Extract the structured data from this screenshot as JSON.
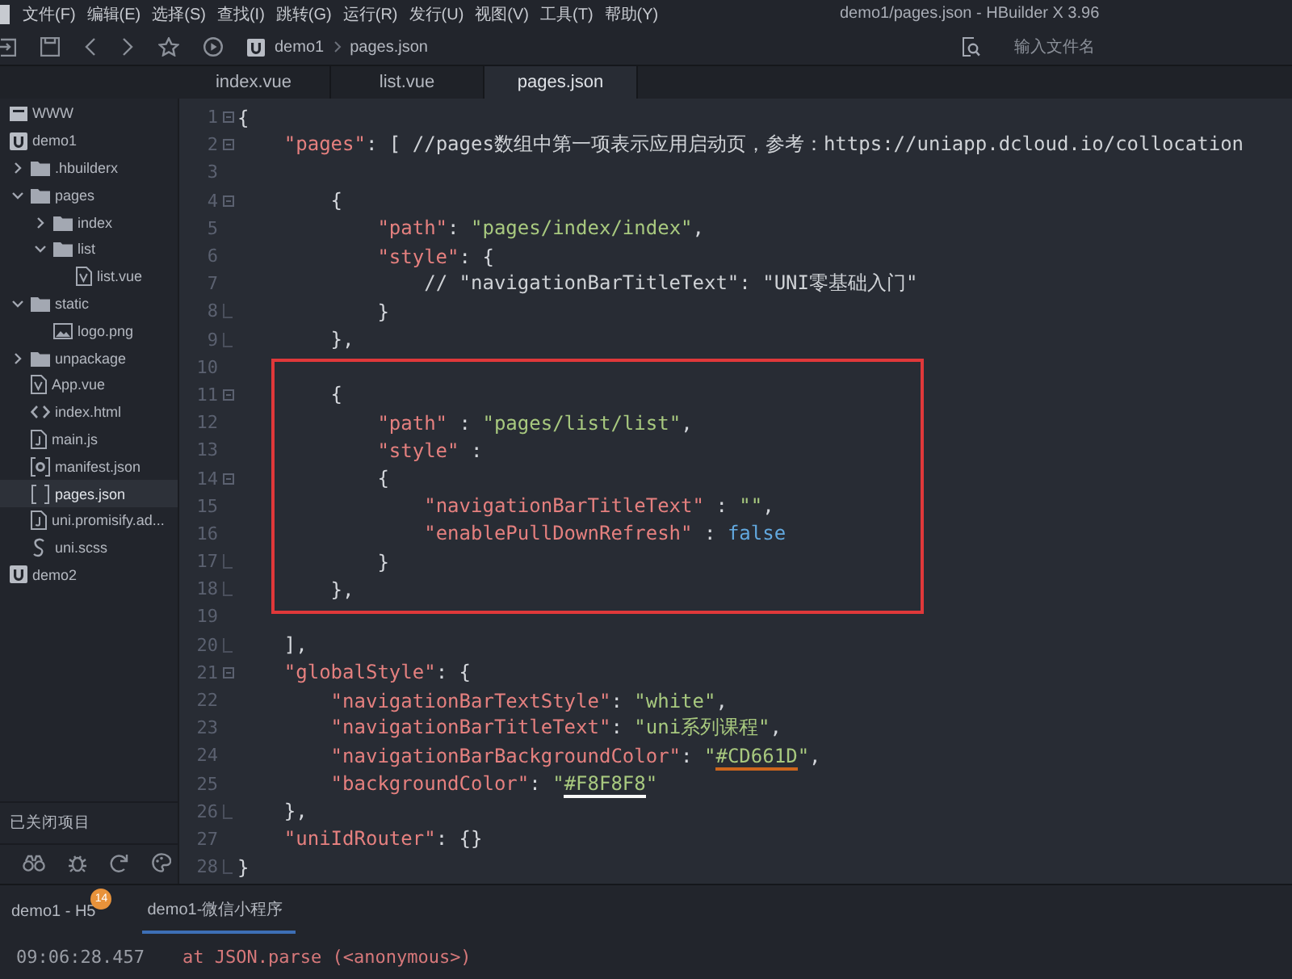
{
  "window": {
    "title": "demo1/pages.json - HBuilder X 3.96"
  },
  "menu": [
    "文件(F)",
    "编辑(E)",
    "选择(S)",
    "查找(I)",
    "跳转(G)",
    "运行(R)",
    "发行(U)",
    "视图(V)",
    "工具(T)",
    "帮助(Y)"
  ],
  "toolbar": {
    "breadcrumb": [
      "demo1",
      "pages.json"
    ],
    "search": {
      "placeholder": "输入文件名"
    }
  },
  "tabs": [
    {
      "label": "index.vue",
      "selected": false
    },
    {
      "label": "list.vue",
      "selected": false
    },
    {
      "label": "pages.json",
      "selected": true
    }
  ],
  "sidebar": {
    "tree": [
      {
        "label": "WWW",
        "kind": "workspace",
        "selected": false
      },
      {
        "label": "demo1",
        "kind": "project",
        "selected": false,
        "children": [
          {
            "label": ".hbuilderx",
            "kind": "folder",
            "expanded": false,
            "selected": false
          },
          {
            "label": "pages",
            "kind": "folder",
            "expanded": true,
            "selected": false,
            "children": [
              {
                "label": "index",
                "kind": "folder",
                "expanded": false,
                "selected": false
              },
              {
                "label": "list",
                "kind": "folder",
                "expanded": true,
                "selected": false,
                "children": [
                  {
                    "label": "list.vue",
                    "kind": "vue",
                    "selected": false
                  }
                ]
              }
            ]
          },
          {
            "label": "static",
            "kind": "folder",
            "expanded": true,
            "selected": false,
            "children": [
              {
                "label": "logo.png",
                "kind": "image",
                "selected": false
              }
            ]
          },
          {
            "label": "unpackage",
            "kind": "folder",
            "expanded": false,
            "selected": false
          },
          {
            "label": "App.vue",
            "kind": "vue",
            "selected": false
          },
          {
            "label": "index.html",
            "kind": "html",
            "selected": false
          },
          {
            "label": "main.js",
            "kind": "js",
            "selected": false
          },
          {
            "label": "manifest.json",
            "kind": "manifest",
            "selected": false
          },
          {
            "label": "pages.json",
            "kind": "json",
            "selected": true
          },
          {
            "label": "uni.promisify.ad...",
            "kind": "js",
            "selected": false
          },
          {
            "label": "uni.scss",
            "kind": "scss",
            "selected": false
          }
        ]
      },
      {
        "label": "demo2",
        "kind": "project",
        "selected": false
      }
    ],
    "closed_projects_label": "已关闭项目"
  },
  "editor": {
    "lines": [
      {
        "number": "1",
        "foldable": true,
        "tokens": [
          {
            "kind": "punct",
            "text": "{"
          }
        ],
        "children": [
          {
            "number": "2",
            "foldable": true,
            "tokens": [
              {
                "kind": "key",
                "text": "\"pages\""
              },
              {
                "kind": "punct",
                "text": ": [ "
              },
              {
                "kind": "comment",
                "text": "//pages数组中第一项表示应用启动页，参考：https://uniapp.dcloud.io/collocation"
              }
            ],
            "children": [
              {
                "number": "3"
              },
              {
                "number": "4",
                "foldable": true,
                "tokens": [
                  {
                    "kind": "punct",
                    "text": "{"
                  }
                ],
                "children": [
                  {
                    "number": "5",
                    "tokens": [
                      {
                        "kind": "key",
                        "text": "\"path\""
                      },
                      {
                        "kind": "punct",
                        "text": ": "
                      },
                      {
                        "kind": "str",
                        "text": "\"pages/index/index\""
                      },
                      {
                        "kind": "punct",
                        "text": ","
                      }
                    ]
                  },
                  {
                    "number": "6",
                    "tokens": [
                      {
                        "kind": "key",
                        "text": "\"style\""
                      },
                      {
                        "kind": "punct",
                        "text": ": {"
                      }
                    ],
                    "children": [
                      {
                        "number": "7",
                        "tokens": [
                          {
                            "kind": "comment",
                            "text": "// \"navigationBarTitleText\": \"UNI零基础入门\""
                          }
                        ]
                      }
                    ]
                  },
                  {
                    "number": "8",
                    "fold_end": true,
                    "tokens": [
                      {
                        "kind": "punct",
                        "text": "}"
                      }
                    ]
                  }
                ]
              },
              {
                "number": "9",
                "fold_end": true,
                "tokens": [
                  {
                    "kind": "punct",
                    "text": "},"
                  }
                ]
              },
              {
                "number": "10",
                "boxed": true
              },
              {
                "number": "11",
                "foldable": true,
                "boxed": true,
                "tokens": [
                  {
                    "kind": "punct",
                    "text": "{"
                  }
                ],
                "children": [
                  {
                    "number": "12",
                    "boxed": true,
                    "tokens": [
                      {
                        "kind": "key",
                        "text": "\"path\""
                      },
                      {
                        "kind": "punct",
                        "text": " : "
                      },
                      {
                        "kind": "str",
                        "text": "\"pages/list/list\""
                      },
                      {
                        "kind": "punct",
                        "text": ","
                      }
                    ]
                  },
                  {
                    "number": "13",
                    "boxed": true,
                    "tokens": [
                      {
                        "kind": "key",
                        "text": "\"style\""
                      },
                      {
                        "kind": "punct",
                        "text": " :"
                      }
                    ]
                  },
                  {
                    "number": "14",
                    "foldable": true,
                    "boxed": true,
                    "tokens": [
                      {
                        "kind": "punct",
                        "text": "{"
                      }
                    ],
                    "children": [
                      {
                        "number": "15",
                        "boxed": true,
                        "tokens": [
                          {
                            "kind": "key",
                            "text": "\"navigationBarTitleText\""
                          },
                          {
                            "kind": "punct",
                            "text": " : "
                          },
                          {
                            "kind": "str",
                            "text": "\"\""
                          },
                          {
                            "kind": "punct",
                            "text": ","
                          }
                        ]
                      },
                      {
                        "number": "16",
                        "boxed": true,
                        "tokens": [
                          {
                            "kind": "key",
                            "text": "\"enablePullDownRefresh\""
                          },
                          {
                            "kind": "punct",
                            "text": " : "
                          },
                          {
                            "kind": "bool",
                            "text": "false"
                          }
                        ]
                      }
                    ]
                  },
                  {
                    "number": "17",
                    "fold_end": true,
                    "boxed": true,
                    "tokens": [
                      {
                        "kind": "punct",
                        "text": "}"
                      }
                    ]
                  }
                ]
              },
              {
                "number": "18",
                "fold_end": true,
                "boxed": true,
                "tokens": [
                  {
                    "kind": "punct",
                    "text": "},"
                  }
                ]
              },
              {
                "number": "19"
              }
            ]
          },
          {
            "number": "20",
            "fold_end": true,
            "tokens": [
              {
                "kind": "punct",
                "text": "],"
              }
            ]
          },
          {
            "number": "21",
            "foldable": true,
            "tokens": [
              {
                "kind": "key",
                "text": "\"globalStyle\""
              },
              {
                "kind": "punct",
                "text": ": {"
              }
            ],
            "children": [
              {
                "number": "22",
                "tokens": [
                  {
                    "kind": "key",
                    "text": "\"navigationBarTextStyle\""
                  },
                  {
                    "kind": "punct",
                    "text": ": "
                  },
                  {
                    "kind": "str",
                    "text": "\"white\""
                  },
                  {
                    "kind": "punct",
                    "text": ","
                  }
                ]
              },
              {
                "number": "23",
                "tokens": [
                  {
                    "kind": "key",
                    "text": "\"navigationBarTitleText\""
                  },
                  {
                    "kind": "punct",
                    "text": ": "
                  },
                  {
                    "kind": "str",
                    "text": "\"uni系列课程\""
                  },
                  {
                    "kind": "punct",
                    "text": ","
                  }
                ]
              },
              {
                "number": "24",
                "tokens": [
                  {
                    "kind": "key",
                    "text": "\"navigationBarBackgroundColor\""
                  },
                  {
                    "kind": "punct",
                    "text": ": "
                  },
                  {
                    "kind": "str",
                    "text": "\""
                  },
                  {
                    "kind": "color",
                    "text": "#CD661D",
                    "color": "#cd661d"
                  },
                  {
                    "kind": "str",
                    "text": "\""
                  },
                  {
                    "kind": "punct",
                    "text": ","
                  }
                ]
              },
              {
                "number": "25",
                "tokens": [
                  {
                    "kind": "key",
                    "text": "\"backgroundColor\""
                  },
                  {
                    "kind": "punct",
                    "text": ": "
                  },
                  {
                    "kind": "str",
                    "text": "\""
                  },
                  {
                    "kind": "color",
                    "text": "#F8F8F8",
                    "color": "#f8f8f8"
                  },
                  {
                    "kind": "str",
                    "text": "\""
                  }
                ]
              }
            ]
          },
          {
            "number": "26",
            "fold_end": true,
            "tokens": [
              {
                "kind": "punct",
                "text": "},"
              }
            ]
          },
          {
            "number": "27",
            "tokens": [
              {
                "kind": "key",
                "text": "\"uniIdRouter\""
              },
              {
                "kind": "punct",
                "text": ": {}"
              }
            ]
          }
        ]
      },
      {
        "number": "28",
        "fold_end": true,
        "tokens": [
          {
            "kind": "punct",
            "text": "}"
          }
        ]
      }
    ]
  },
  "panel": {
    "tabs": [
      {
        "label": "demo1 - H5",
        "badge": "14",
        "selected": false
      },
      {
        "label": "demo1-微信小程序",
        "selected": true
      }
    ],
    "console": [
      {
        "time": "09:06:28.457",
        "message": "at JSON.parse (<anonymous>)"
      }
    ]
  }
}
